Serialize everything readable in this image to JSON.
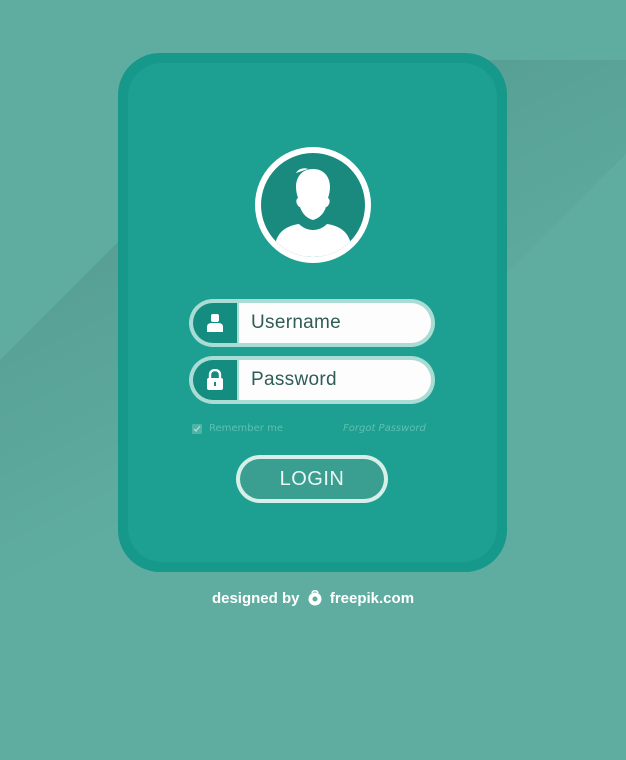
{
  "login_form": {
    "username_placeholder": "Username",
    "password_placeholder": "Password",
    "remember_label": "Remember me",
    "forgot_label": "Forgot Password",
    "login_label": "LOGIN"
  },
  "credit": {
    "designed_by": "designed by",
    "brand": "freepik.com"
  },
  "icons": {
    "avatar": "user-silhouette-icon",
    "username": "user-icon",
    "password": "lock-icon",
    "remember": "checkmark-icon",
    "brand_logo": "freepik-logo-icon"
  },
  "colors": {
    "background": "#5fada1",
    "card": "#1da091",
    "card_border": "#16988a",
    "field_icon_bg": "#148c7f",
    "field_bg": "#fdfdfd",
    "text_dark": "#2f5c57",
    "muted_text": "#5cc0b1"
  }
}
